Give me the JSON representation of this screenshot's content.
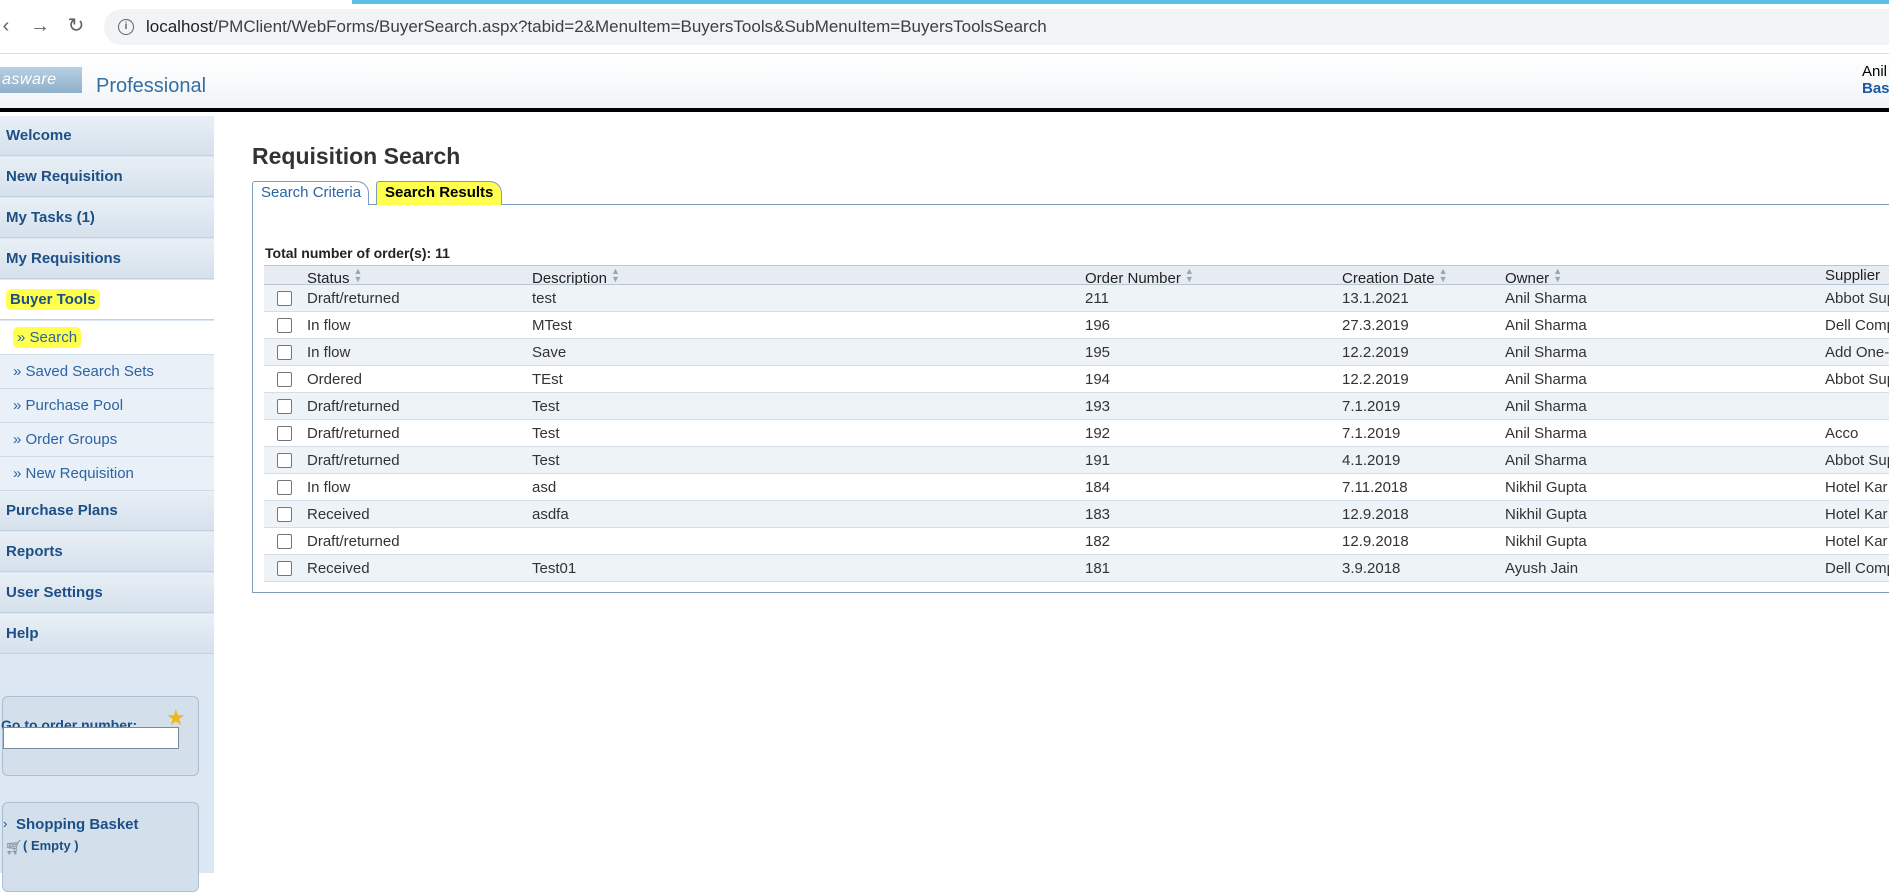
{
  "browser": {
    "back_icon": "back-arrow-icon",
    "forward_icon": "forward-arrow-icon",
    "reload_icon": "reload-icon",
    "info_icon": "info-icon",
    "url_host": "localhost",
    "url_path": "/PMClient/WebForms/BuyerSearch.aspx?tabid=2&MenuItem=BuyersTools&SubMenuItem=BuyersToolsSearch"
  },
  "header": {
    "logo_text": "asware",
    "product": "Professional",
    "user_name": "Anil",
    "user_link": "Bas"
  },
  "sidebar": {
    "items": [
      {
        "label": "Welcome"
      },
      {
        "label": "New Requisition"
      },
      {
        "label": "My Tasks (1)"
      },
      {
        "label": "My Requisitions"
      },
      {
        "label": "Buyer Tools"
      }
    ],
    "subitems": [
      {
        "label": "» Search"
      },
      {
        "label": "» Saved Search Sets"
      },
      {
        "label": "» Purchase Pool"
      },
      {
        "label": "» Order Groups"
      },
      {
        "label": "» New Requisition"
      }
    ],
    "items2": [
      {
        "label": "Purchase Plans"
      },
      {
        "label": "Reports"
      },
      {
        "label": "User Settings"
      },
      {
        "label": "Help"
      }
    ],
    "goto_label": "Go to order number:",
    "goto_value": "",
    "basket_label": "Shopping Basket",
    "basket_status": "( Empty )"
  },
  "main": {
    "title": "Requisition Search",
    "tabs": [
      {
        "label": "Search Criteria"
      },
      {
        "label": "Search Results"
      }
    ],
    "total_label": "Total number of order(s): 11",
    "columns": [
      "Status",
      "Description",
      "Order Number",
      "Creation Date",
      "Owner",
      "Supplier"
    ],
    "rows": [
      {
        "status": "Draft/returned",
        "description": "test",
        "order": "211",
        "date": "13.1.2021",
        "owner": "Anil Sharma",
        "supplier": "Abbot Sup"
      },
      {
        "status": "In flow",
        "description": "MTest",
        "order": "196",
        "date": "27.3.2019",
        "owner": "Anil Sharma",
        "supplier": "Dell Comp"
      },
      {
        "status": "In flow",
        "description": "Save",
        "order": "195",
        "date": "12.2.2019",
        "owner": "Anil Sharma",
        "supplier": "Add One-"
      },
      {
        "status": "Ordered",
        "description": "TEst",
        "order": "194",
        "date": "12.2.2019",
        "owner": "Anil Sharma",
        "supplier": "Abbot Sup"
      },
      {
        "status": "Draft/returned",
        "description": "Test",
        "order": "193",
        "date": "7.1.2019",
        "owner": "Anil Sharma",
        "supplier": ""
      },
      {
        "status": "Draft/returned",
        "description": "Test",
        "order": "192",
        "date": "7.1.2019",
        "owner": "Anil Sharma",
        "supplier": "Acco"
      },
      {
        "status": "Draft/returned",
        "description": "Test",
        "order": "191",
        "date": "4.1.2019",
        "owner": "Anil Sharma",
        "supplier": "Abbot Sup"
      },
      {
        "status": "In flow",
        "description": "asd",
        "order": "184",
        "date": "7.11.2018",
        "owner": "Nikhil Gupta",
        "supplier": "Hotel Kar"
      },
      {
        "status": "Received",
        "description": "asdfa",
        "order": "183",
        "date": "12.9.2018",
        "owner": "Nikhil Gupta",
        "supplier": "Hotel Kar"
      },
      {
        "status": "Draft/returned",
        "description": "",
        "order": "182",
        "date": "12.9.2018",
        "owner": "Nikhil Gupta",
        "supplier": "Hotel Kar"
      },
      {
        "status": "Received",
        "description": "Test01",
        "order": "181",
        "date": "3.9.2018",
        "owner": "Ayush Jain",
        "supplier": "Dell Comp"
      }
    ]
  },
  "colors": {
    "highlight": "#ffff4d",
    "menu_text": "#1d4f86",
    "link": "#2a64a3",
    "sidebar_bg": "#dde7f1"
  }
}
